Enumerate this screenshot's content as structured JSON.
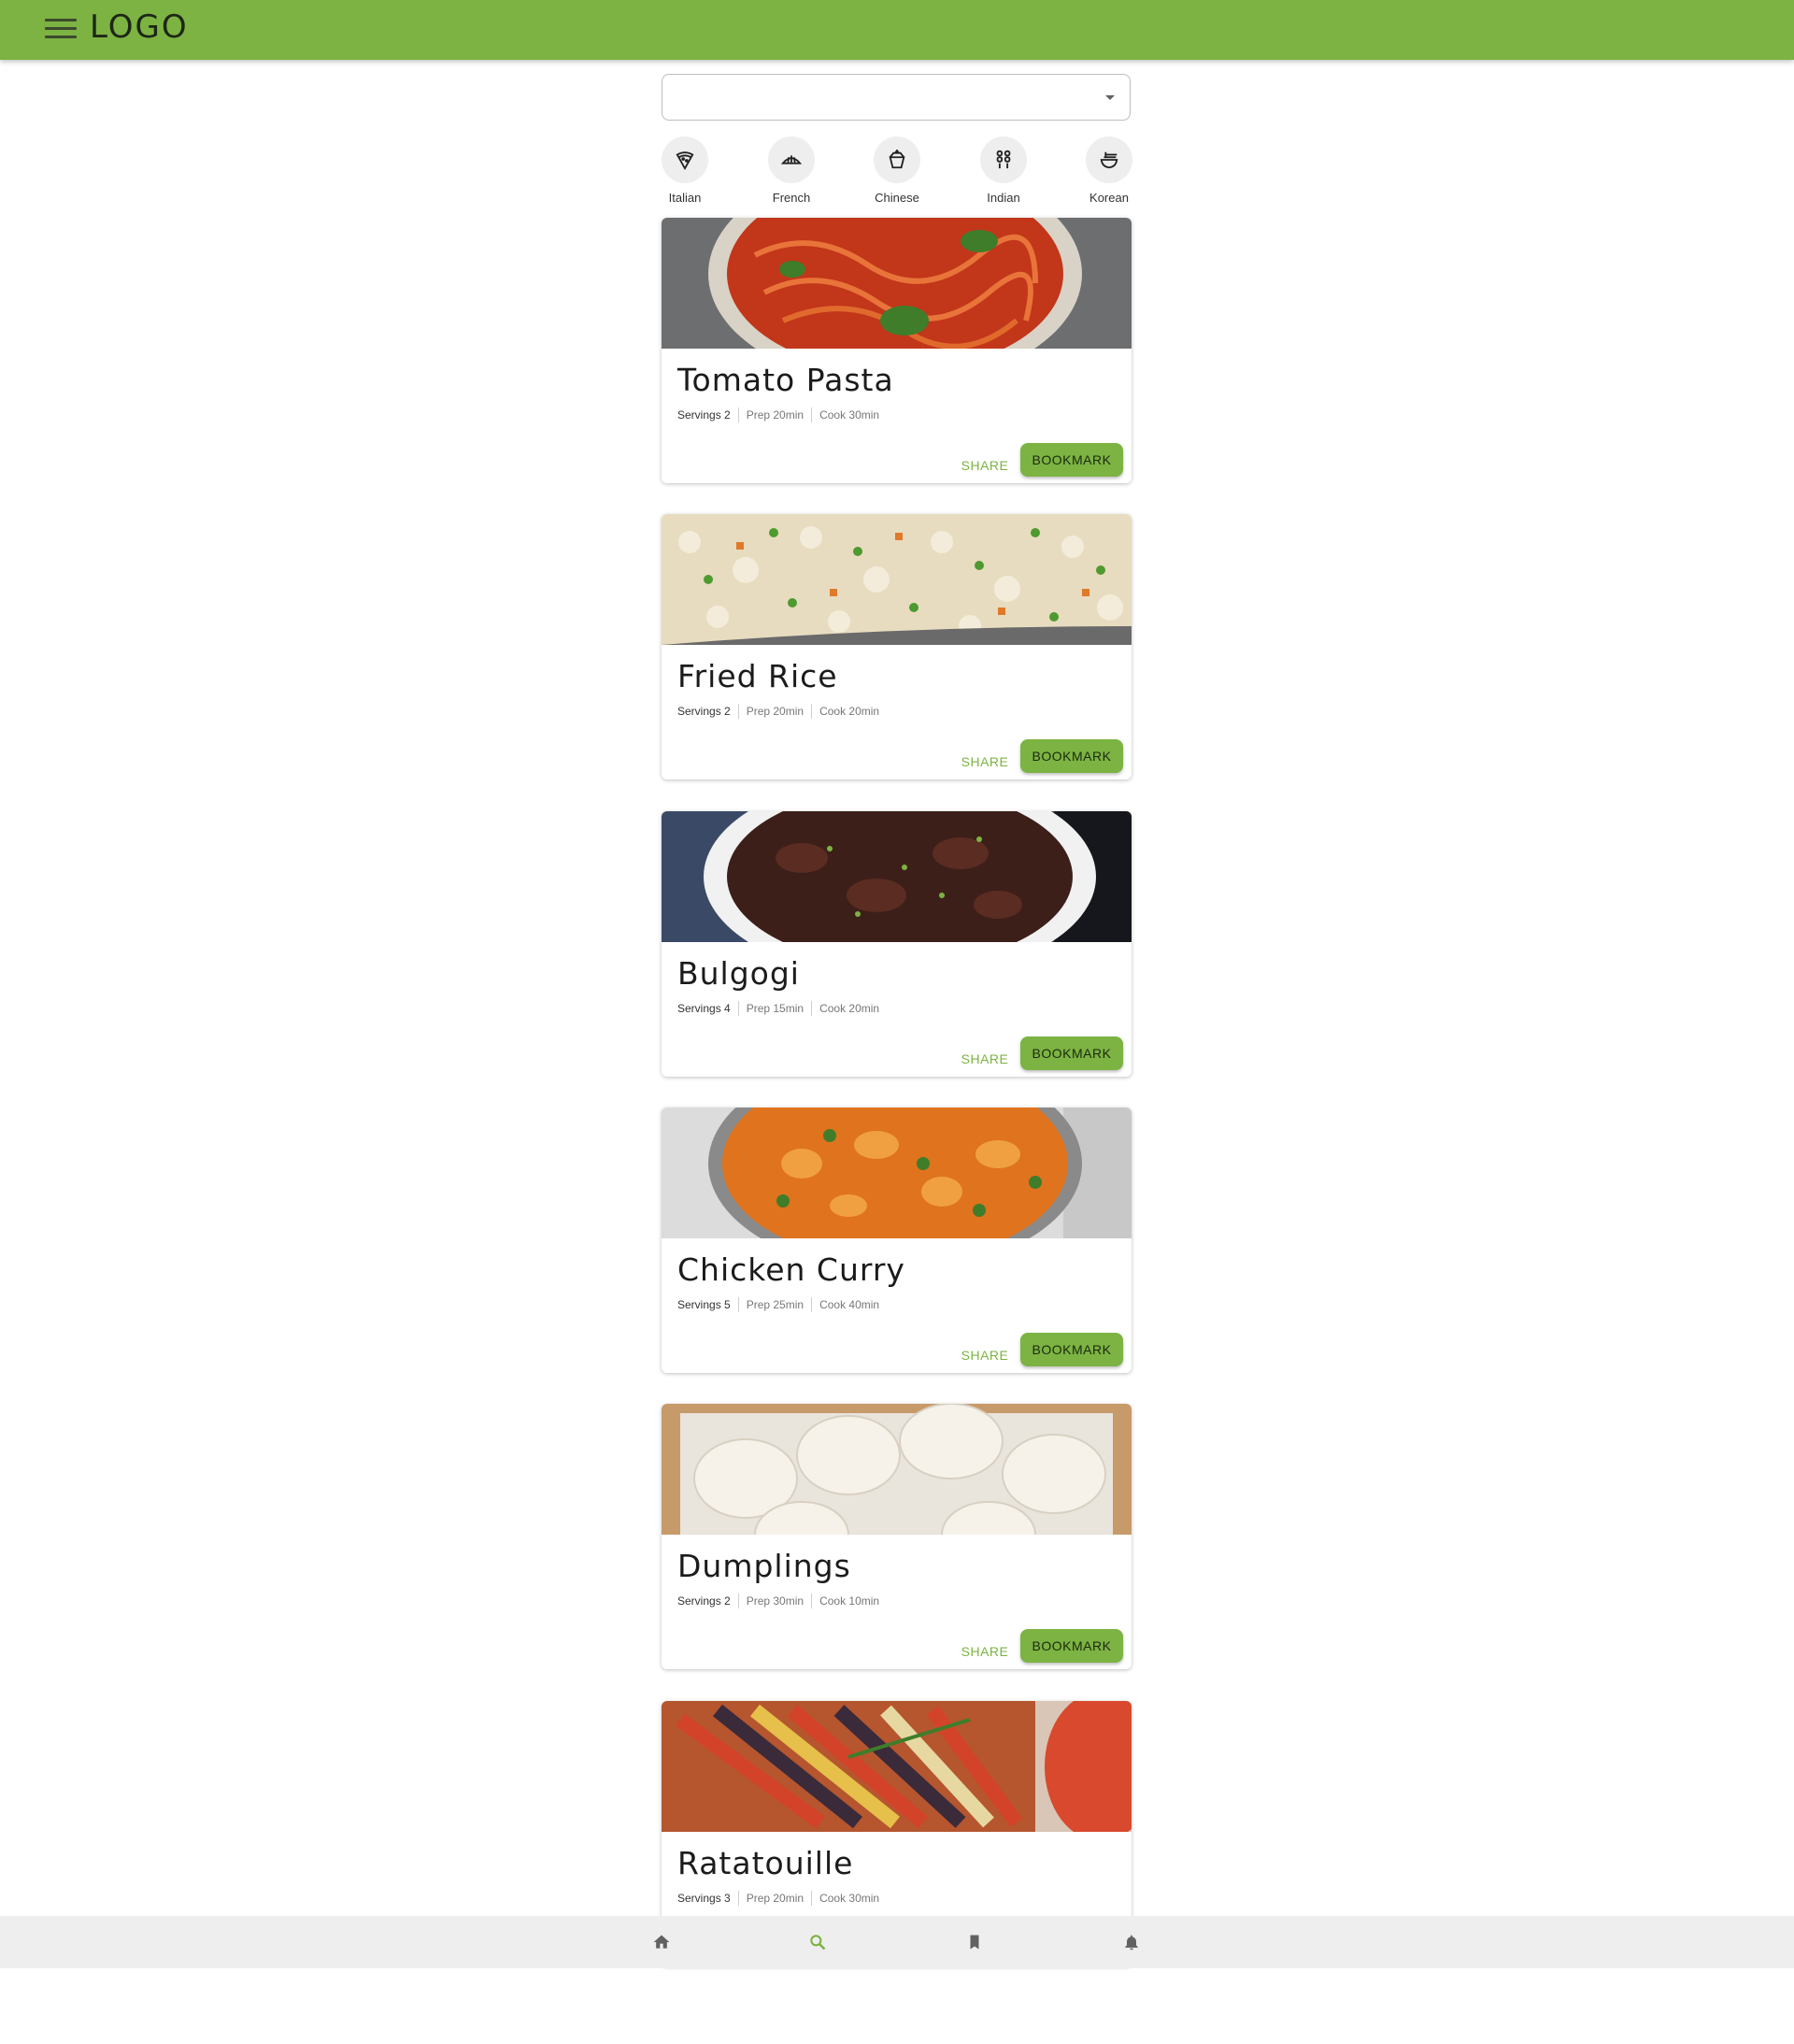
{
  "app": {
    "logo": "LOGO"
  },
  "search": {
    "value": ""
  },
  "categories": [
    {
      "label": "Italian",
      "icon": "pizza-icon"
    },
    {
      "label": "French",
      "icon": "croissant-icon"
    },
    {
      "label": "Chinese",
      "icon": "takeout-box-icon"
    },
    {
      "label": "Indian",
      "icon": "kebab-icon"
    },
    {
      "label": "Korean",
      "icon": "ramen-bowl-icon"
    }
  ],
  "actions": {
    "share": "SHARE",
    "bookmark": "BOOKMARK"
  },
  "recipes": [
    {
      "title": "Tomato Pasta",
      "servings": "Servings 2",
      "prep": "Prep 20min",
      "cook": "Cook 30min"
    },
    {
      "title": "Fried Rice",
      "servings": "Servings 2",
      "prep": "Prep 20min",
      "cook": "Cook 20min"
    },
    {
      "title": "Bulgogi",
      "servings": "Servings 4",
      "prep": "Prep 15min",
      "cook": "Cook 20min"
    },
    {
      "title": "Chicken Curry",
      "servings": "Servings 5",
      "prep": "Prep 25min",
      "cook": "Cook 40min"
    },
    {
      "title": "Dumplings",
      "servings": "Servings 2",
      "prep": "Prep 30min",
      "cook": "Cook 10min"
    },
    {
      "title": "Ratatouille",
      "servings": "Servings 3",
      "prep": "Prep 20min",
      "cook": "Cook 30min"
    }
  ],
  "bottom_nav": [
    {
      "icon": "home-icon",
      "active": false
    },
    {
      "icon": "search-icon",
      "active": true
    },
    {
      "icon": "bookmark-icon",
      "active": false
    },
    {
      "icon": "bell-icon",
      "active": false
    }
  ],
  "colors": {
    "accent": "#7cb342",
    "nav_bg": "#eeeeee",
    "chip_bg": "#eeeeee"
  }
}
